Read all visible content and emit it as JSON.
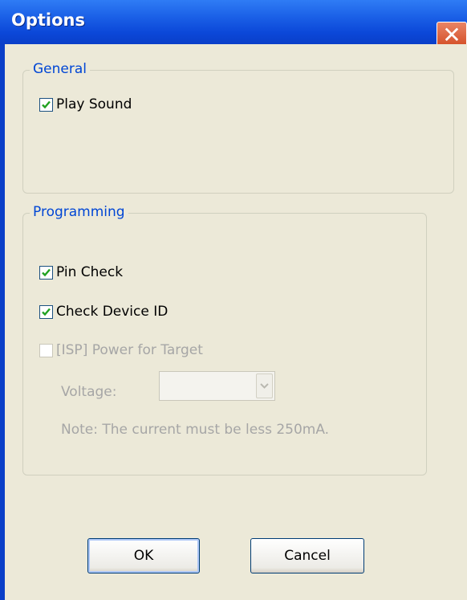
{
  "window": {
    "title": "Options",
    "close_glyph": "✕"
  },
  "general": {
    "label": "General",
    "play_sound": {
      "label": "Play Sound",
      "checked": true
    }
  },
  "programming": {
    "label": "Programming",
    "pin_check": {
      "label": "Pin Check",
      "checked": true
    },
    "check_device_id": {
      "label": "Check Device ID",
      "checked": true
    },
    "isp_power": {
      "label": "[ISP] Power for Target",
      "checked": false,
      "enabled": false
    },
    "voltage_label": "Voltage:",
    "voltage_value": "",
    "note": "Note: The current must be less 250mA."
  },
  "buttons": {
    "ok": "OK",
    "cancel": "Cancel"
  },
  "colors": {
    "title_bar": "#0a3fc8",
    "group_label": "#0046d5",
    "client_bg": "#ece9d8",
    "checkmark": "#21a121"
  }
}
